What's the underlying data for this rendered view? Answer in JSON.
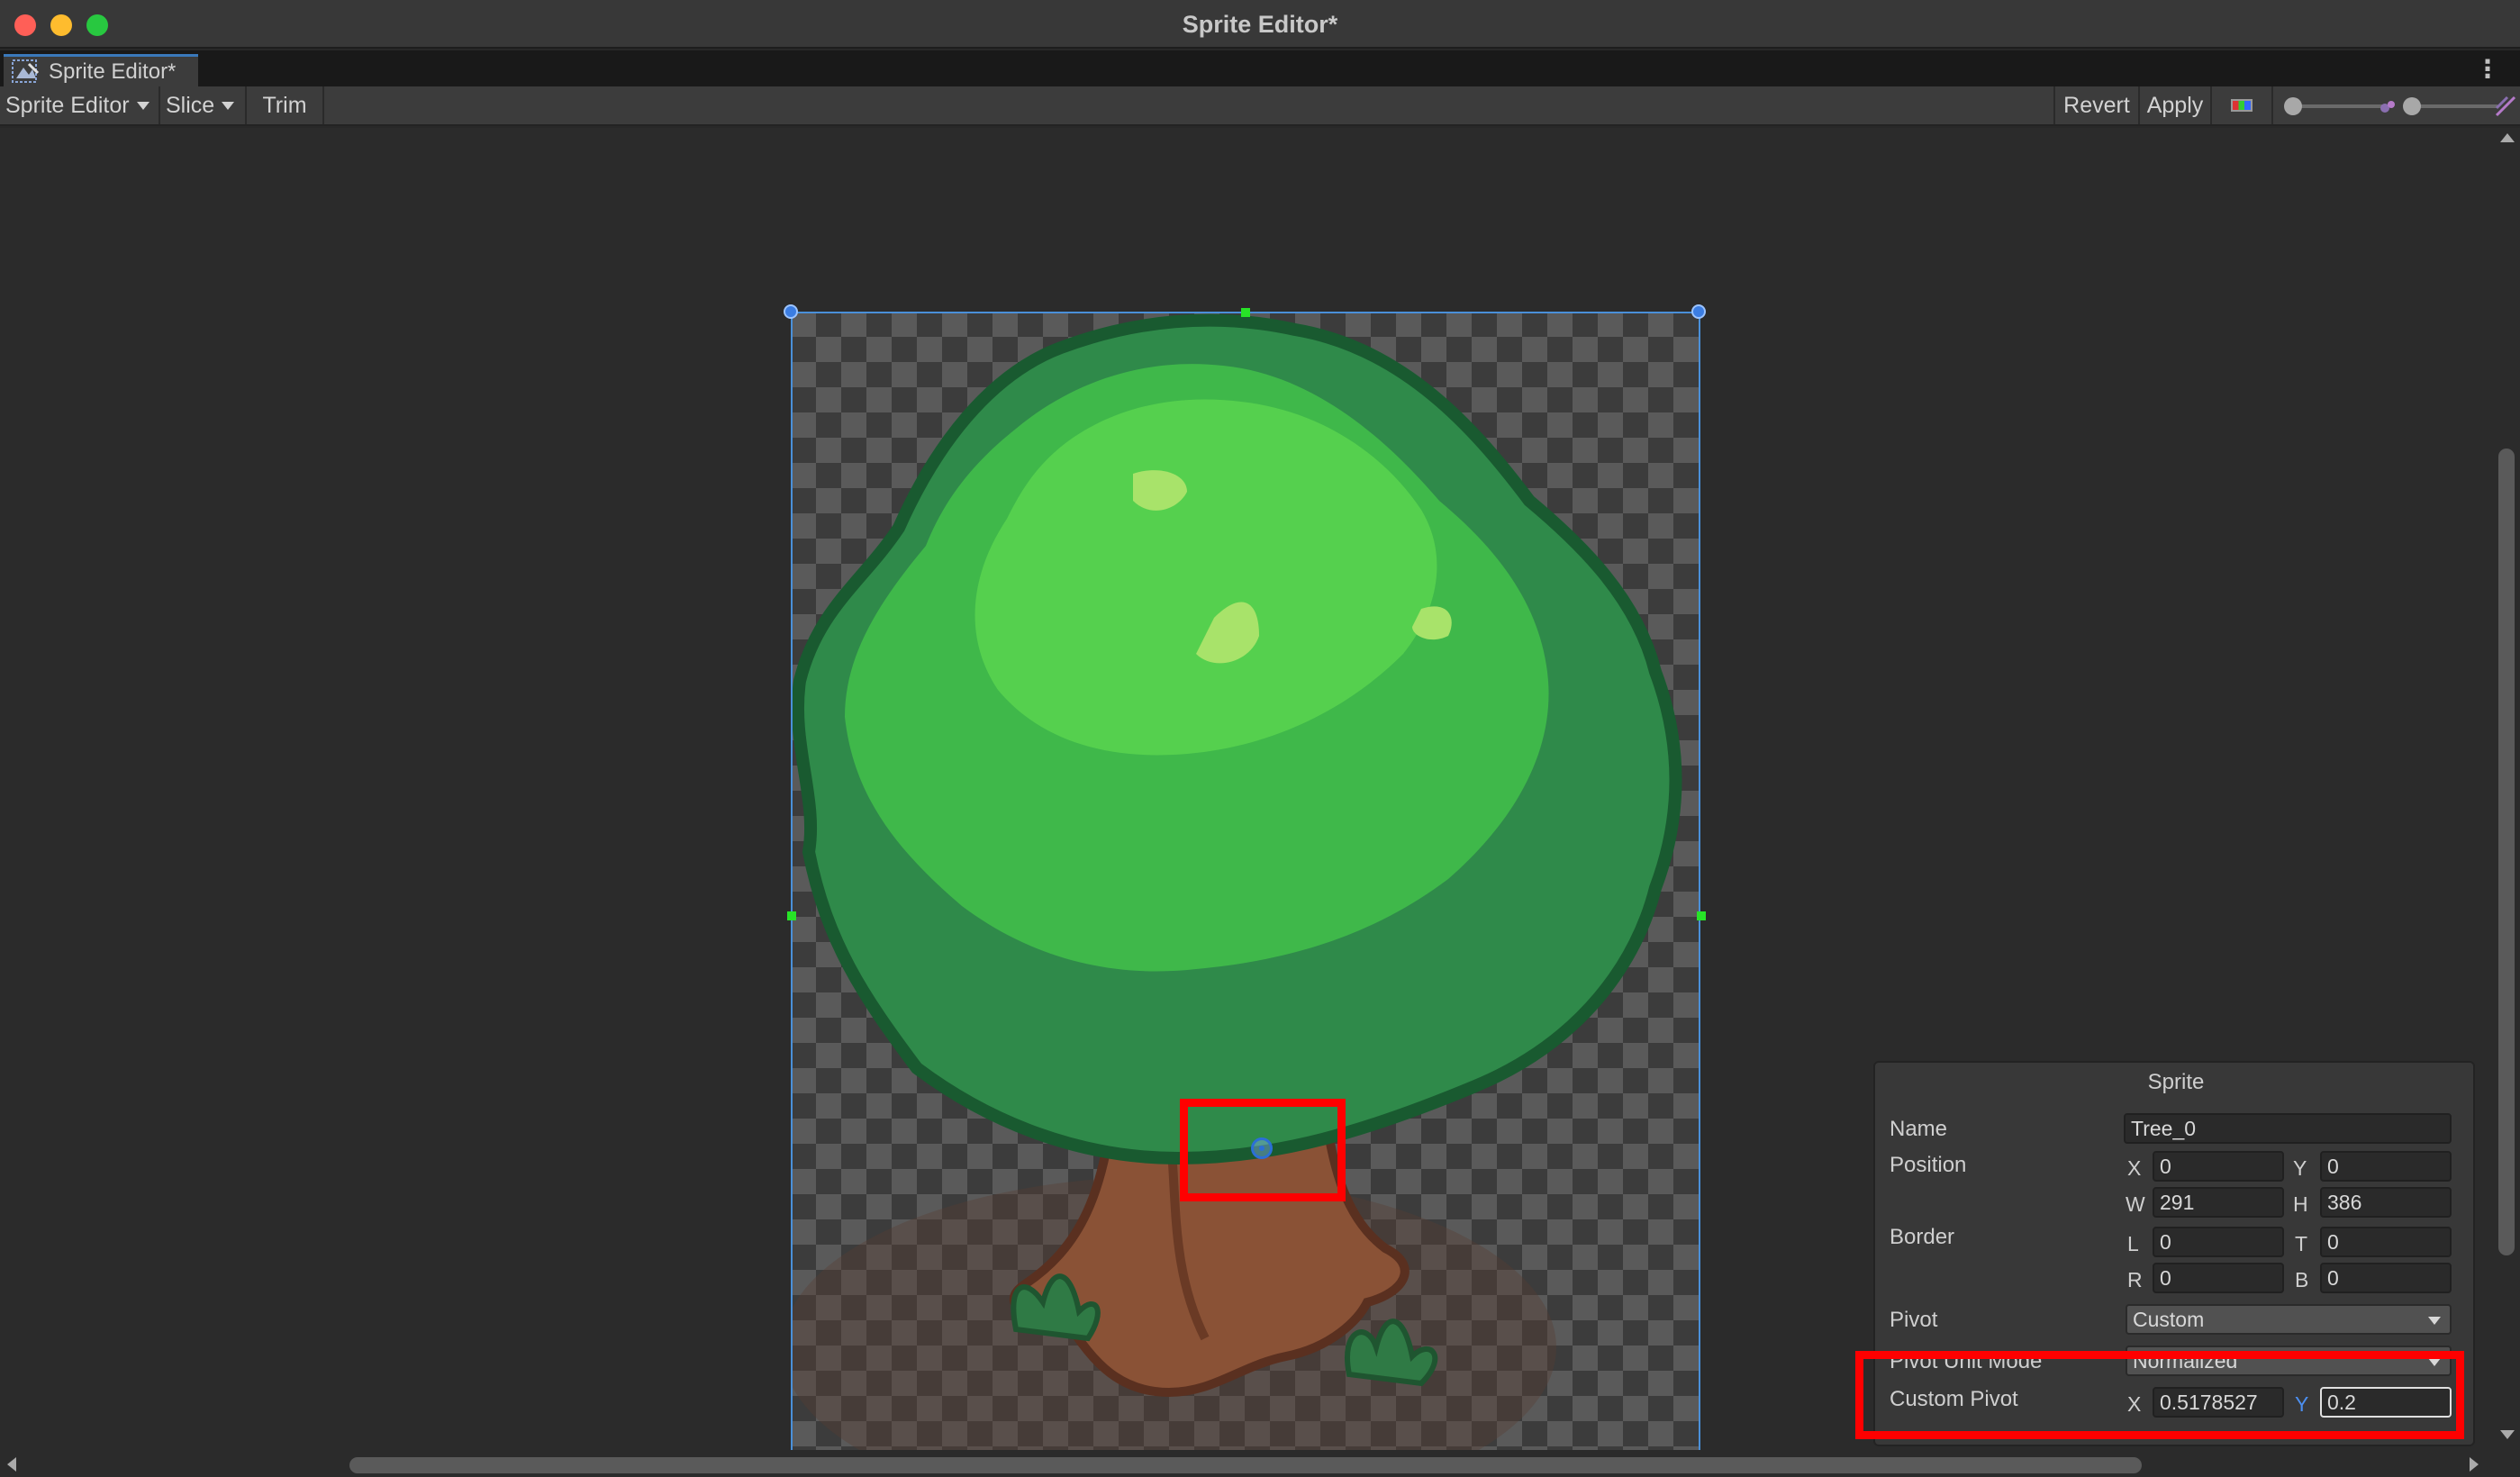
{
  "window": {
    "title": "Sprite Editor*"
  },
  "tab": {
    "label": "Sprite Editor*",
    "menu_icon": "more-vertical-icon"
  },
  "toolbar": {
    "sprite_editor_label": "Sprite Editor",
    "slice_label": "Slice",
    "trim_label": "Trim",
    "revert_label": "Revert",
    "apply_label": "Apply",
    "color_icon": "rgb-channel-icon"
  },
  "inspector": {
    "title": "Sprite",
    "name_label": "Name",
    "name_value": "Tree_0",
    "position_label": "Position",
    "x_label": "X",
    "x_value": "0",
    "y_label": "Y",
    "y_value": "0",
    "w_label": "W",
    "w_value": "291",
    "h_label": "H",
    "h_value": "386",
    "border_label": "Border",
    "l_label": "L",
    "l_value": "0",
    "t_label": "T",
    "t_value": "0",
    "r_label": "R",
    "r_value": "0",
    "b_label": "B",
    "b_value": "0",
    "pivot_label": "Pivot",
    "pivot_value": "Custom",
    "pivot_unit_mode_label": "Pivot Unit Mode",
    "pivot_unit_mode_value": "Normalized",
    "custom_pivot_label": "Custom Pivot",
    "custom_pivot_x_label": "X",
    "custom_pivot_x_value": "0.5178527",
    "custom_pivot_y_label": "Y",
    "custom_pivot_y_value": "0.2"
  },
  "colors": {
    "highlight": "#ff0000",
    "selection": "#4a90d9",
    "edge_handle": "#27e327"
  }
}
